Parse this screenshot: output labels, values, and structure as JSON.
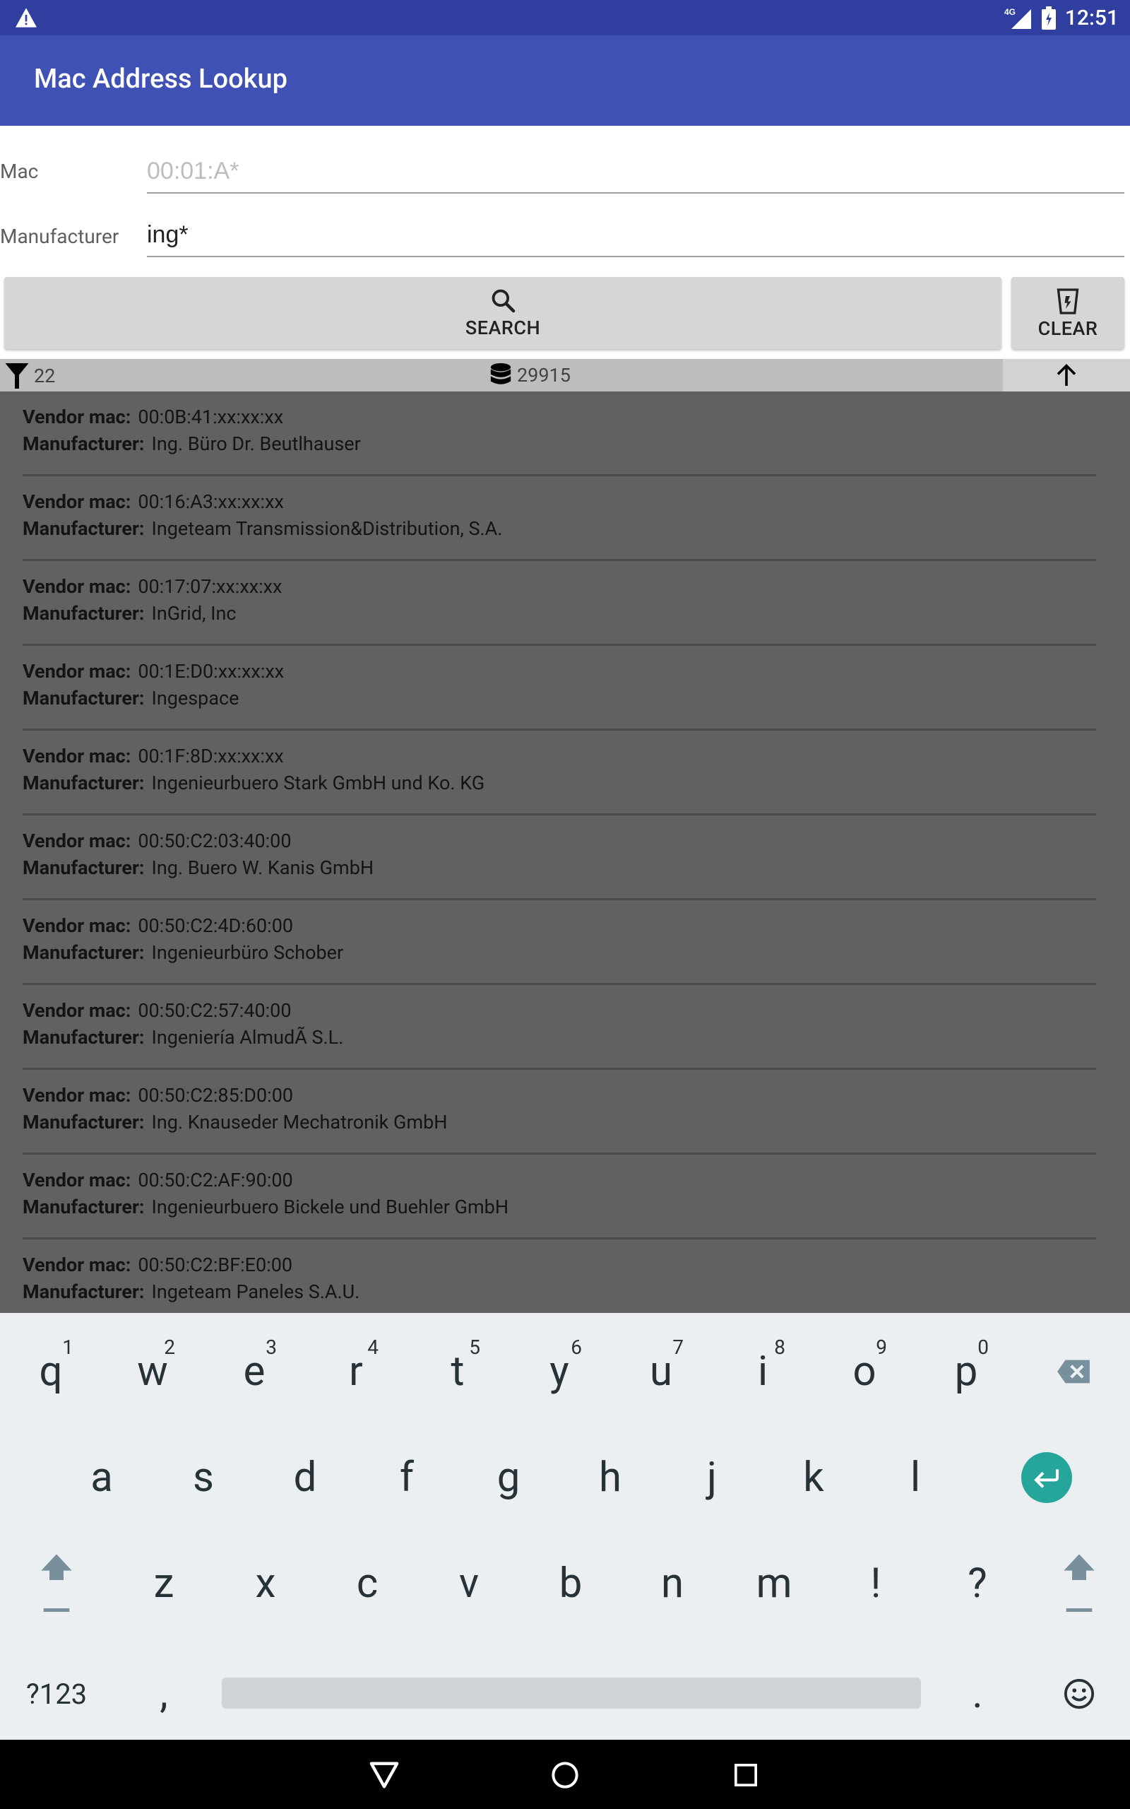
{
  "status_bar": {
    "network": "4G",
    "time": "12:51"
  },
  "app": {
    "title": "Mac Address Lookup"
  },
  "form": {
    "mac_label": "Mac",
    "mac_placeholder": "00:01:A*",
    "mac_value": "",
    "manufacturer_label": "Manufacturer",
    "manufacturer_value": "ing*",
    "search_label": "SEARCH",
    "clear_label": "CLEAR"
  },
  "stats": {
    "filter_count": "22",
    "database_count": "29915"
  },
  "results": {
    "vendor_label": "Vendor mac:",
    "manufacturer_label": "Manufacturer:",
    "items": [
      {
        "mac": "00:0B:41:xx:xx:xx",
        "manufacturer": "Ing. Büro Dr. Beutlhauser"
      },
      {
        "mac": "00:16:A3:xx:xx:xx",
        "manufacturer": "Ingeteam Transmission&Distribution, S.A."
      },
      {
        "mac": "00:17:07:xx:xx:xx",
        "manufacturer": "InGrid, Inc"
      },
      {
        "mac": "00:1E:D0:xx:xx:xx",
        "manufacturer": "Ingespace"
      },
      {
        "mac": "00:1F:8D:xx:xx:xx",
        "manufacturer": "Ingenieurbuero Stark GmbH und Ko. KG"
      },
      {
        "mac": "00:50:C2:03:40:00",
        "manufacturer": "Ing. Buero W. Kanis GmbH"
      },
      {
        "mac": "00:50:C2:4D:60:00",
        "manufacturer": "Ingenieurbüro Schober"
      },
      {
        "mac": "00:50:C2:57:40:00",
        "manufacturer": "Ingeniería AlmudÃ S.L."
      },
      {
        "mac": "00:50:C2:85:D0:00",
        "manufacturer": "Ing. Knauseder Mechatronik GmbH"
      },
      {
        "mac": "00:50:C2:AF:90:00",
        "manufacturer": "Ingenieurbuero Bickele und Buehler GmbH"
      },
      {
        "mac": "00:50:C2:BF:E0:00",
        "manufacturer": "Ingeteam Paneles S.A.U."
      }
    ]
  },
  "keyboard": {
    "row1": [
      "q",
      "w",
      "e",
      "r",
      "t",
      "y",
      "u",
      "i",
      "o",
      "p"
    ],
    "row1_hints": [
      "1",
      "2",
      "3",
      "4",
      "5",
      "6",
      "7",
      "8",
      "9",
      "0"
    ],
    "row2": [
      "a",
      "s",
      "d",
      "f",
      "g",
      "h",
      "j",
      "k",
      "l"
    ],
    "row3": [
      "z",
      "x",
      "c",
      "v",
      "b",
      "n",
      "m",
      "!",
      "?"
    ],
    "symbols_key": "?123",
    "comma_key": ",",
    "period_key": "."
  },
  "colors": {
    "status_bar": "#303F9F",
    "app_bar": "#3F51B5",
    "results_bg": "#616161",
    "enter_key": "#26A69A"
  }
}
